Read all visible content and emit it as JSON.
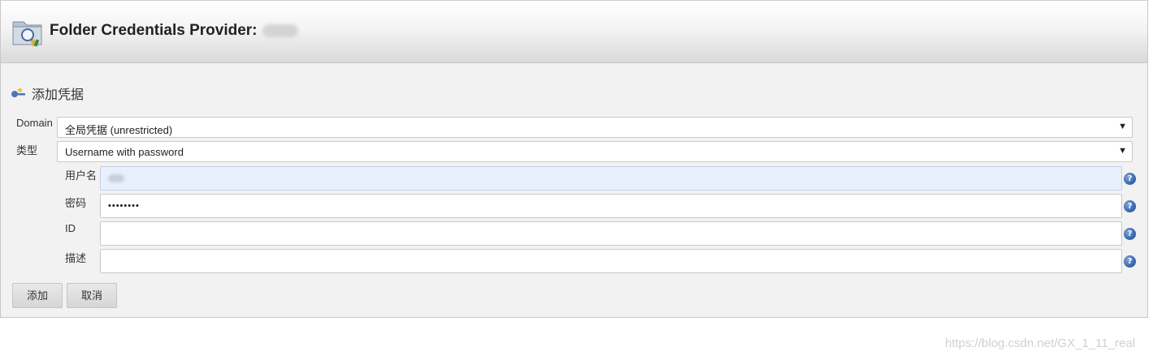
{
  "header": {
    "title": "Folder Credentials Provider:",
    "icon": "folder-credentials-icon"
  },
  "section": {
    "title": "添加凭据",
    "icon": "key-icon"
  },
  "form": {
    "domain": {
      "label": "Domain",
      "value": "全局凭据 (unrestricted)"
    },
    "kind": {
      "label": "类型",
      "value": "Username with password"
    },
    "username": {
      "label": "用户名",
      "value": ""
    },
    "password": {
      "label": "密码",
      "value": "••••••••"
    },
    "id": {
      "label": "ID",
      "value": ""
    },
    "description": {
      "label": "描述",
      "value": ""
    },
    "help_glyph": "?"
  },
  "buttons": {
    "add": "添加",
    "cancel": "取消"
  },
  "watermark": "https://blog.csdn.net/GX_1_11_real",
  "colors": {
    "autofill_bg": "#e8f0fe",
    "help_icon": "#2e5fa8",
    "panel_bg": "#f2f2f2"
  }
}
